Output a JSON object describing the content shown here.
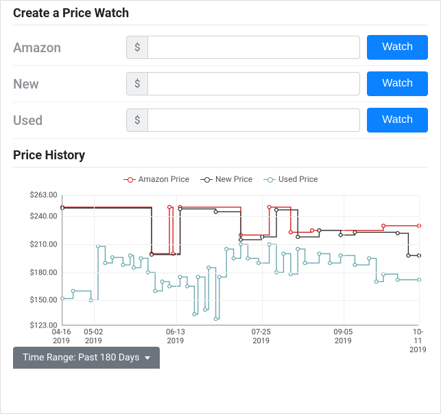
{
  "priceWatch": {
    "title": "Create a Price Watch",
    "rows": [
      {
        "label": "Amazon",
        "prefix": "$",
        "button": "Watch"
      },
      {
        "label": "New",
        "prefix": "$",
        "button": "Watch"
      },
      {
        "label": "Used",
        "prefix": "$",
        "button": "Watch"
      }
    ]
  },
  "priceHistory": {
    "title": "Price History",
    "legend": {
      "amazon": "Amazon Price",
      "new": "New Price",
      "used": "Used Price"
    }
  },
  "timeRange": {
    "label": "Time Range: Past 180 Days"
  },
  "chart_data": {
    "type": "line",
    "title": "Price History",
    "xlabel": "",
    "ylabel": "",
    "ylim": [
      123,
      263
    ],
    "yticks": [
      123,
      150,
      180,
      210,
      240,
      263
    ],
    "ytick_labels": [
      "$123.00",
      "$150.00",
      "$180.00",
      "$210.00",
      "$240.00",
      "$263.00"
    ],
    "xtick_positions": [
      0,
      0.09,
      0.32,
      0.56,
      0.79,
      1.0
    ],
    "xtick_labels": [
      "04-16\n2019",
      "05-02\n2019",
      "06-13\n2019",
      "07-25\n2019",
      "09-05\n2019",
      "10-11\n2019"
    ],
    "series": [
      {
        "name": "Amazon Price",
        "color": "#d62020",
        "points": [
          {
            "x": 0.0,
            "y": 250
          },
          {
            "x": 0.25,
            "y": 250
          },
          {
            "x": 0.25,
            "y": 200
          },
          {
            "x": 0.3,
            "y": 200
          },
          {
            "x": 0.3,
            "y": 250
          },
          {
            "x": 0.31,
            "y": 250
          },
          {
            "x": 0.31,
            "y": 200
          },
          {
            "x": 0.33,
            "y": 200
          },
          {
            "x": 0.33,
            "y": 250
          },
          {
            "x": 0.5,
            "y": 250
          },
          {
            "x": 0.5,
            "y": 220
          },
          {
            "x": 0.58,
            "y": 220
          },
          {
            "x": 0.58,
            "y": 250
          },
          {
            "x": 0.64,
            "y": 250
          },
          {
            "x": 0.64,
            "y": 223
          },
          {
            "x": 0.7,
            "y": 223
          },
          {
            "x": 0.7,
            "y": 225
          },
          {
            "x": 0.9,
            "y": 225
          },
          {
            "x": 0.9,
            "y": 230
          },
          {
            "x": 1.0,
            "y": 230
          }
        ]
      },
      {
        "name": "New Price",
        "color": "#333333",
        "points": [
          {
            "x": 0.0,
            "y": 249
          },
          {
            "x": 0.25,
            "y": 249
          },
          {
            "x": 0.25,
            "y": 199
          },
          {
            "x": 0.33,
            "y": 199
          },
          {
            "x": 0.33,
            "y": 248
          },
          {
            "x": 0.43,
            "y": 248
          },
          {
            "x": 0.43,
            "y": 245
          },
          {
            "x": 0.5,
            "y": 245
          },
          {
            "x": 0.5,
            "y": 215
          },
          {
            "x": 0.56,
            "y": 215
          },
          {
            "x": 0.56,
            "y": 218
          },
          {
            "x": 0.6,
            "y": 218
          },
          {
            "x": 0.6,
            "y": 247
          },
          {
            "x": 0.66,
            "y": 247
          },
          {
            "x": 0.66,
            "y": 218
          },
          {
            "x": 0.72,
            "y": 218
          },
          {
            "x": 0.72,
            "y": 225
          },
          {
            "x": 0.78,
            "y": 225
          },
          {
            "x": 0.78,
            "y": 220
          },
          {
            "x": 0.82,
            "y": 220
          },
          {
            "x": 0.82,
            "y": 223
          },
          {
            "x": 0.94,
            "y": 223
          },
          {
            "x": 0.94,
            "y": 222
          },
          {
            "x": 0.97,
            "y": 222
          },
          {
            "x": 0.97,
            "y": 198
          },
          {
            "x": 1.0,
            "y": 198
          }
        ]
      },
      {
        "name": "Used Price",
        "color": "#6aa9af",
        "points": [
          {
            "x": 0.0,
            "y": 152
          },
          {
            "x": 0.03,
            "y": 152
          },
          {
            "x": 0.03,
            "y": 160
          },
          {
            "x": 0.08,
            "y": 160
          },
          {
            "x": 0.08,
            "y": 150
          },
          {
            "x": 0.1,
            "y": 150
          },
          {
            "x": 0.1,
            "y": 208
          },
          {
            "x": 0.12,
            "y": 208
          },
          {
            "x": 0.12,
            "y": 190
          },
          {
            "x": 0.14,
            "y": 190
          },
          {
            "x": 0.14,
            "y": 196
          },
          {
            "x": 0.17,
            "y": 196
          },
          {
            "x": 0.17,
            "y": 188
          },
          {
            "x": 0.19,
            "y": 188
          },
          {
            "x": 0.19,
            "y": 198
          },
          {
            "x": 0.2,
            "y": 198
          },
          {
            "x": 0.2,
            "y": 185
          },
          {
            "x": 0.22,
            "y": 185
          },
          {
            "x": 0.22,
            "y": 195
          },
          {
            "x": 0.24,
            "y": 195
          },
          {
            "x": 0.24,
            "y": 180
          },
          {
            "x": 0.26,
            "y": 180
          },
          {
            "x": 0.26,
            "y": 160
          },
          {
            "x": 0.28,
            "y": 160
          },
          {
            "x": 0.28,
            "y": 170
          },
          {
            "x": 0.3,
            "y": 170
          },
          {
            "x": 0.3,
            "y": 165
          },
          {
            "x": 0.33,
            "y": 165
          },
          {
            "x": 0.33,
            "y": 175
          },
          {
            "x": 0.35,
            "y": 175
          },
          {
            "x": 0.35,
            "y": 165
          },
          {
            "x": 0.37,
            "y": 165
          },
          {
            "x": 0.37,
            "y": 135
          },
          {
            "x": 0.38,
            "y": 135
          },
          {
            "x": 0.38,
            "y": 175
          },
          {
            "x": 0.4,
            "y": 175
          },
          {
            "x": 0.4,
            "y": 140
          },
          {
            "x": 0.41,
            "y": 140
          },
          {
            "x": 0.41,
            "y": 185
          },
          {
            "x": 0.43,
            "y": 185
          },
          {
            "x": 0.43,
            "y": 130
          },
          {
            "x": 0.44,
            "y": 130
          },
          {
            "x": 0.44,
            "y": 175
          },
          {
            "x": 0.46,
            "y": 175
          },
          {
            "x": 0.46,
            "y": 205
          },
          {
            "x": 0.48,
            "y": 205
          },
          {
            "x": 0.48,
            "y": 195
          },
          {
            "x": 0.5,
            "y": 195
          },
          {
            "x": 0.5,
            "y": 210
          },
          {
            "x": 0.52,
            "y": 210
          },
          {
            "x": 0.52,
            "y": 195
          },
          {
            "x": 0.55,
            "y": 195
          },
          {
            "x": 0.55,
            "y": 190
          },
          {
            "x": 0.58,
            "y": 190
          },
          {
            "x": 0.58,
            "y": 210
          },
          {
            "x": 0.6,
            "y": 210
          },
          {
            "x": 0.6,
            "y": 180
          },
          {
            "x": 0.62,
            "y": 180
          },
          {
            "x": 0.62,
            "y": 200
          },
          {
            "x": 0.64,
            "y": 200
          },
          {
            "x": 0.64,
            "y": 178
          },
          {
            "x": 0.66,
            "y": 178
          },
          {
            "x": 0.66,
            "y": 205
          },
          {
            "x": 0.68,
            "y": 205
          },
          {
            "x": 0.68,
            "y": 190
          },
          {
            "x": 0.72,
            "y": 190
          },
          {
            "x": 0.72,
            "y": 200
          },
          {
            "x": 0.75,
            "y": 200
          },
          {
            "x": 0.75,
            "y": 190
          },
          {
            "x": 0.78,
            "y": 190
          },
          {
            "x": 0.78,
            "y": 198
          },
          {
            "x": 0.82,
            "y": 198
          },
          {
            "x": 0.82,
            "y": 188
          },
          {
            "x": 0.86,
            "y": 188
          },
          {
            "x": 0.86,
            "y": 195
          },
          {
            "x": 0.88,
            "y": 195
          },
          {
            "x": 0.88,
            "y": 170
          },
          {
            "x": 0.9,
            "y": 170
          },
          {
            "x": 0.9,
            "y": 178
          },
          {
            "x": 0.94,
            "y": 178
          },
          {
            "x": 0.94,
            "y": 172
          },
          {
            "x": 1.0,
            "y": 172
          }
        ]
      }
    ]
  }
}
